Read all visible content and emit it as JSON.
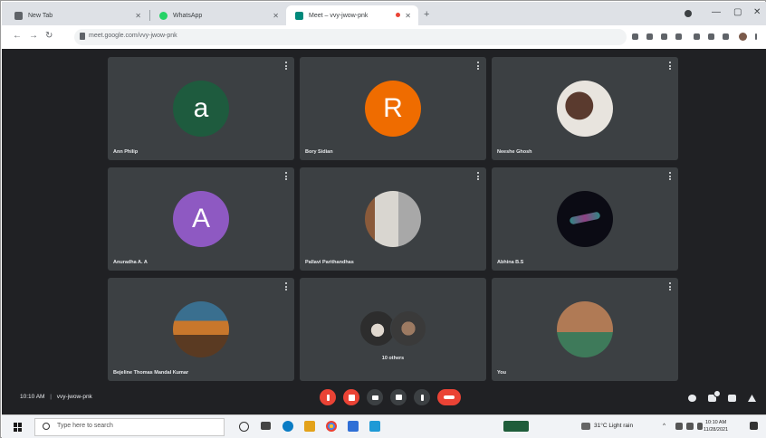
{
  "browser": {
    "tabs": [
      {
        "title": "New Tab",
        "favicon_color": "#5f6368",
        "active": false
      },
      {
        "title": "WhatsApp",
        "favicon_color": "#25d366",
        "active": false
      },
      {
        "title": "Meet – vvy-jwow-pnk",
        "favicon_color": "#00897b",
        "active": true
      }
    ],
    "url": "meet.google.com/vvy-jwow-pnk"
  },
  "meet": {
    "tiles": [
      {
        "name": "Ann Philip",
        "kind": "initial",
        "initial": "a",
        "color": "#1e5b3e"
      },
      {
        "name": "Bory Sidian",
        "kind": "initial",
        "initial": "R",
        "color": "#ef6c00"
      },
      {
        "name": "Neeshe Ghosh",
        "kind": "photo",
        "photo_colors": [
          "#7a5a4a",
          "#e8e4de"
        ]
      },
      {
        "name": "Anuradha A. A",
        "kind": "initial",
        "initial": "A",
        "color": "#8e59c2"
      },
      {
        "name": "Pallavi Parithandhas",
        "kind": "photo",
        "photo_colors": [
          "#a8a8a8",
          "#c7c2bb"
        ]
      },
      {
        "name": "Abhina B.S",
        "kind": "photo",
        "photo_colors": [
          "#0b0b14",
          "#3aa6a0"
        ]
      },
      {
        "name": "Bejeline Thomas Mandal Kumar",
        "kind": "photo",
        "photo_colors": [
          "#3a6f8f",
          "#c8772c"
        ]
      },
      {
        "name": "10 others",
        "kind": "pair",
        "photo_colors": [
          "#6a6a6a",
          "#2d2d2d"
        ]
      },
      {
        "name": "You",
        "kind": "photo",
        "photo_colors": [
          "#b07a55",
          "#3e7a5a"
        ]
      }
    ],
    "time": "10:10 AM",
    "divider": "|",
    "meeting_code": "vvy-jwow-pnk"
  },
  "controls": [
    "microphone-off",
    "camera-off",
    "captions",
    "present-now",
    "more-options",
    "leave-call"
  ],
  "taskbar": {
    "search_placeholder": "Type here to search",
    "weather": "31°C  Light rain",
    "time": "10:10 AM",
    "date": "11/28/2021"
  },
  "colors": {
    "meet_background": "#202124",
    "tile_background": "#3c4043",
    "end_call": "#ea4335"
  }
}
